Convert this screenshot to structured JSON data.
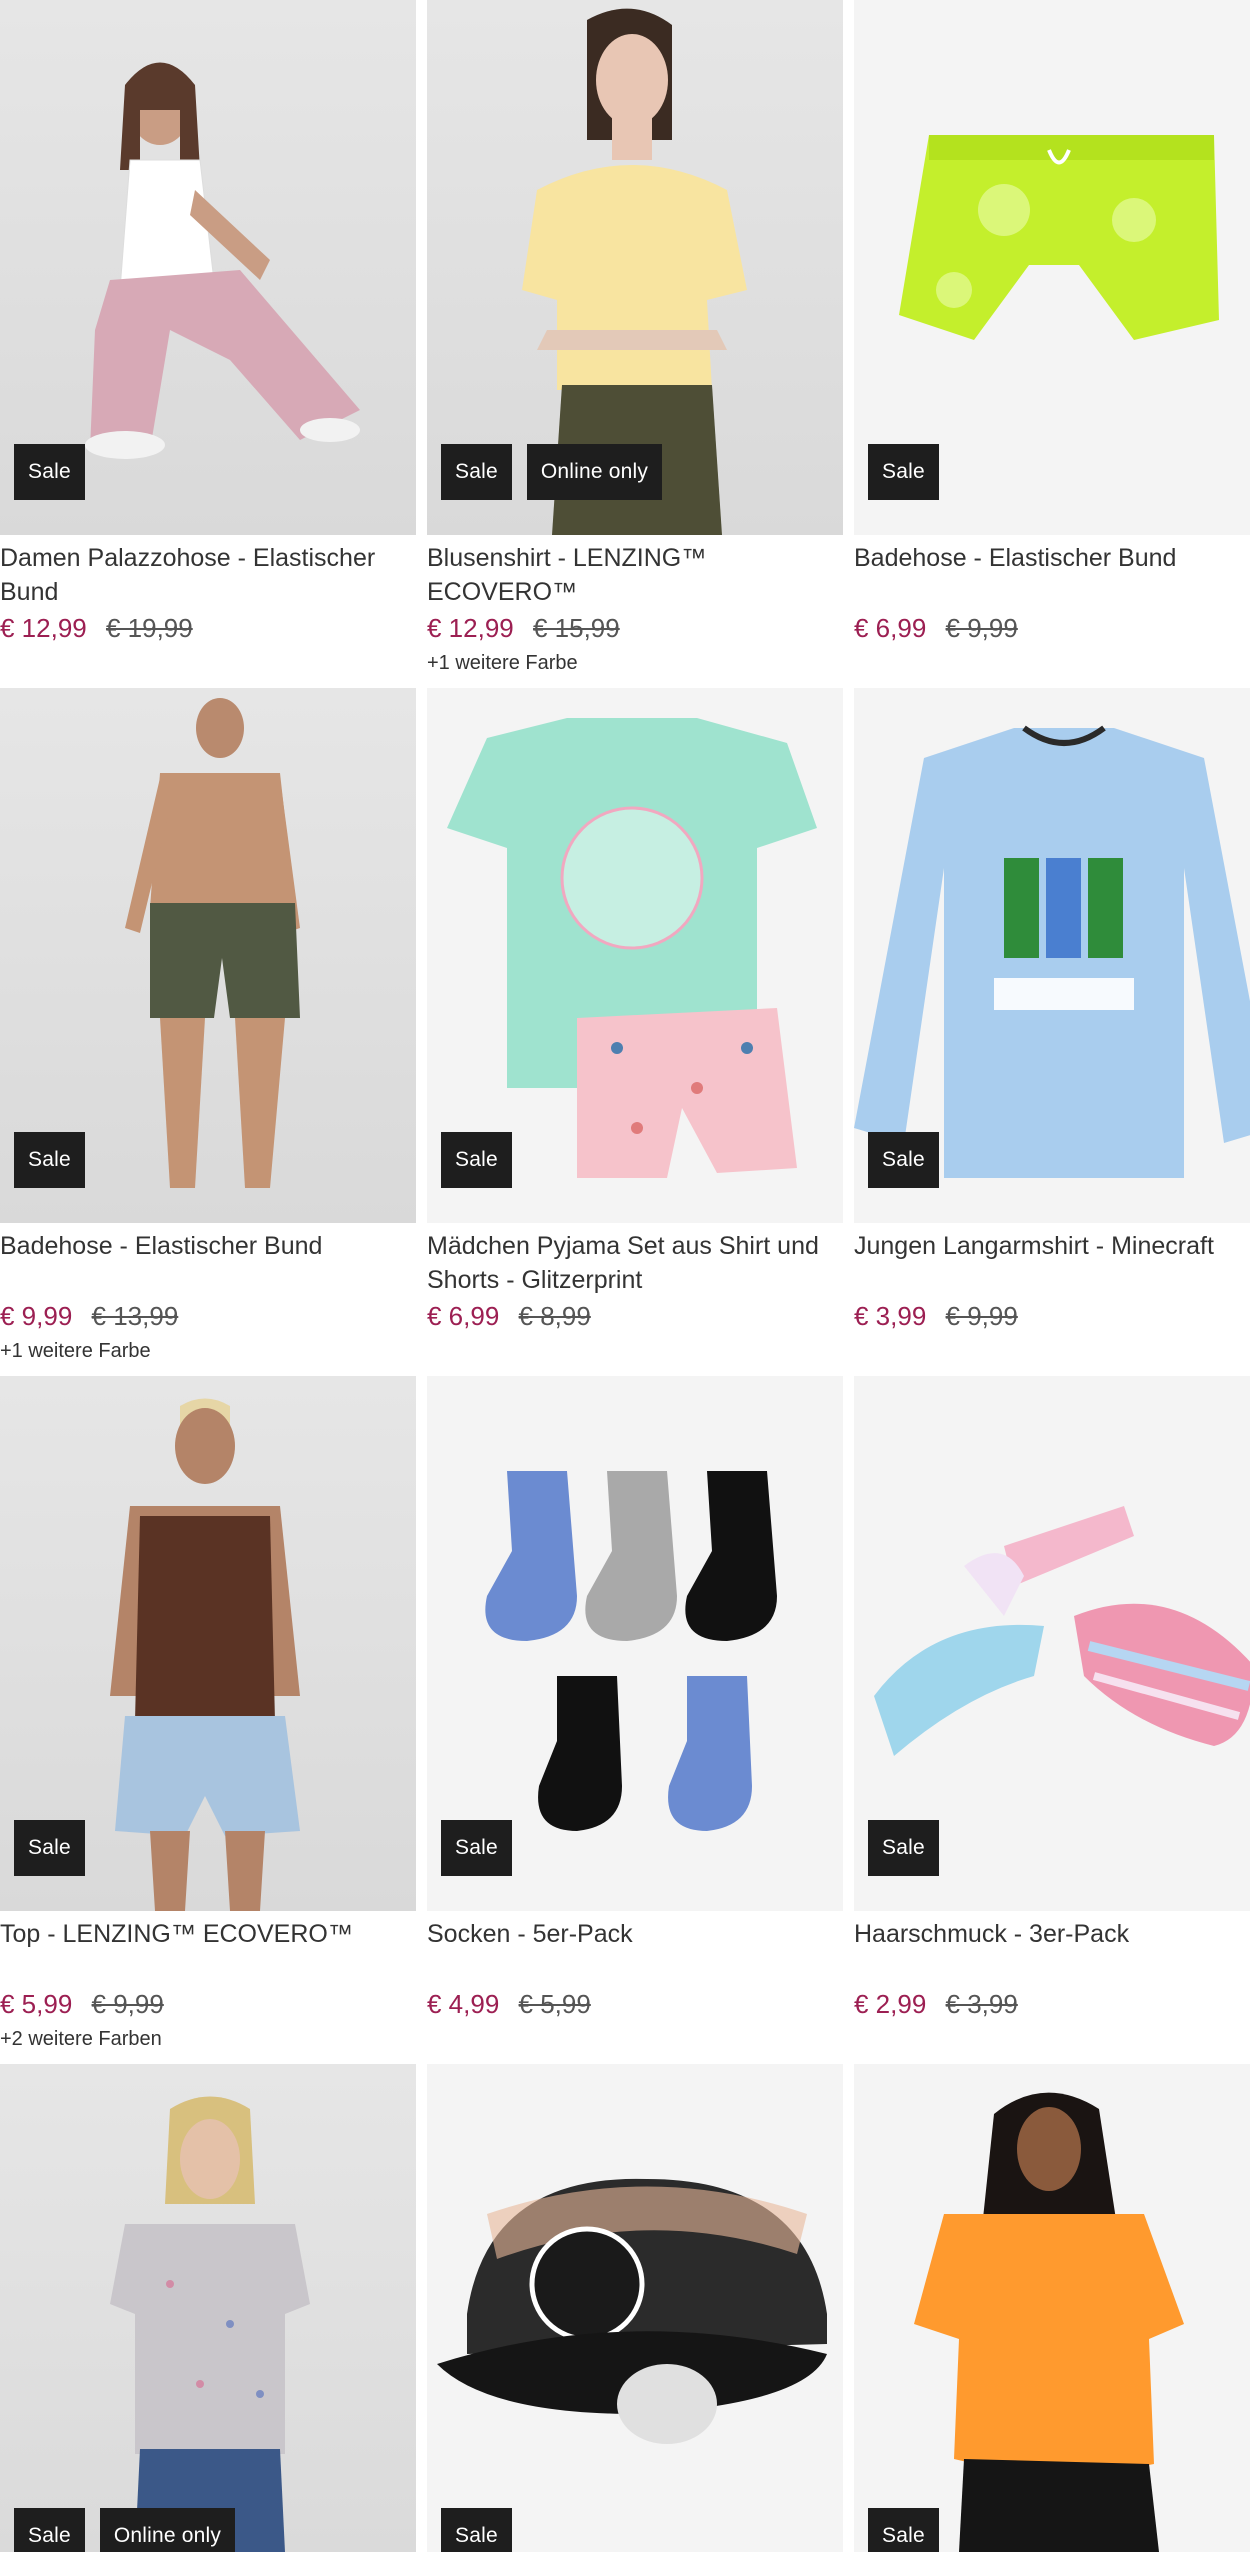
{
  "colors": {
    "sale_price": "#9c1f52",
    "badge_bg": "#1e1e1e",
    "badge_text": "#ffffff"
  },
  "products": [
    {
      "title": "Damen Palazzohose - Elastischer Bund",
      "price": "€ 12,99",
      "old_price": "€ 19,99",
      "colors": "",
      "badges": [
        "Sale"
      ],
      "image": "woman-pink-palazzo-pants-image"
    },
    {
      "title": "Blusenshirt - LENZING™ ECOVERO™",
      "price": "€ 12,99",
      "old_price": "€ 15,99",
      "colors": "+1 weitere Farbe",
      "badges": [
        "Sale",
        "Online only"
      ],
      "image": "woman-yellow-blouse-image"
    },
    {
      "title": "Badehose - Elastischer Bund",
      "price": "€ 6,99",
      "old_price": "€ 9,99",
      "colors": "",
      "badges": [
        "Sale"
      ],
      "image": "neon-swim-shorts-image"
    },
    {
      "title": "Badehose - Elastischer Bund",
      "price": "€ 9,99",
      "old_price": "€ 13,99",
      "colors": "+1 weitere Farbe",
      "badges": [
        "Sale"
      ],
      "image": "man-olive-swim-shorts-image"
    },
    {
      "title": "Mädchen Pyjama Set aus Shirt und Shorts - Glitzerprint",
      "price": "€ 6,99",
      "old_price": "€ 8,99",
      "colors": "",
      "badges": [
        "Sale"
      ],
      "image": "girls-pyjama-set-image"
    },
    {
      "title": "Jungen Langarmshirt - Minecraft",
      "price": "€ 3,99",
      "old_price": "€ 9,99",
      "colors": "",
      "badges": [
        "Sale"
      ],
      "image": "boys-minecraft-longsleeve-image"
    },
    {
      "title": "Top - LENZING™ ECOVERO™",
      "price": "€ 5,99",
      "old_price": "€ 9,99",
      "colors": "+2 weitere Farben",
      "badges": [
        "Sale"
      ],
      "image": "woman-brown-top-image"
    },
    {
      "title": "Socken - 5er-Pack",
      "price": "€ 4,99",
      "old_price": "€ 5,99",
      "colors": "",
      "badges": [
        "Sale"
      ],
      "image": "socks-5-pack-image"
    },
    {
      "title": "Haarschmuck - 3er-Pack",
      "price": "€ 2,99",
      "old_price": "€ 3,99",
      "colors": "",
      "badges": [
        "Sale"
      ],
      "image": "hair-accessories-image"
    },
    {
      "title": "",
      "price": "",
      "old_price": "",
      "colors": "",
      "badges": [
        "Sale",
        "Online only"
      ],
      "image": "woman-floral-tshirt-image"
    },
    {
      "title": "",
      "price": "",
      "old_price": "",
      "colors": "",
      "badges": [
        "Sale"
      ],
      "image": "nyc-cap-image"
    },
    {
      "title": "",
      "price": "",
      "old_price": "",
      "colors": "",
      "badges": [
        "Sale"
      ],
      "image": "woman-orange-tshirt-image"
    }
  ]
}
